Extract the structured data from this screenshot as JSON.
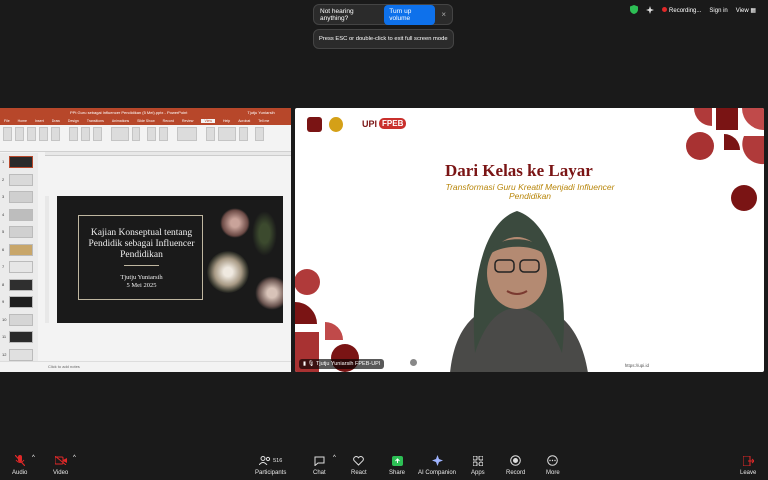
{
  "notices": {
    "hearing_text": "Not hearing anything?",
    "turn_up_label": "Turn up volume",
    "close_glyph": "×",
    "fullscreen_text": "Press ESC or double-click to exit full screen mode"
  },
  "top_right": {
    "recording_label": "Recording...",
    "signin_label": "Sign in",
    "view_label": "View"
  },
  "ppt": {
    "window_title": "PPt Guru sebagai Influencer Pendidikan (5 Mei).pptx - PowerPoint",
    "user_name": "Tjutju Yuniarsih",
    "tabs": [
      "File",
      "Home",
      "Insert",
      "Draw",
      "Design",
      "Transitions",
      "Animations",
      "Slide Show",
      "Record",
      "Review",
      "View",
      "Help",
      "Acrobat",
      "Tell me"
    ],
    "active_tab": "View",
    "slide_numbers": [
      "1",
      "2",
      "3",
      "4",
      "5",
      "6",
      "7",
      "8",
      "9",
      "10",
      "11",
      "12"
    ],
    "notes_placeholder": "Click to add notes",
    "slide": {
      "title": "Kajian Konseptual tentang Pendidik sebagai Influencer Pendidikan",
      "author": "Tjutju Yuniarsih",
      "date": "5 Mei 2025"
    }
  },
  "video": {
    "title": "Dari Kelas ke Layar",
    "subtitle": "Transformasi Guru Kreatif Menjadi Influencer Pendidikan",
    "logo_text": "UPI",
    "logo_badge": "FPEB",
    "participant_name": "Tjutju Yuniarsih FPEB-UPI",
    "url": "https://upi.id"
  },
  "toolbar": {
    "audio_label": "Audio",
    "video_label": "Video",
    "participants_label": "Participants",
    "participants_count": "516",
    "chat_label": "Chat",
    "react_label": "React",
    "share_label": "Share",
    "ai_label": "AI Companion",
    "apps_label": "Apps",
    "record_label": "Record",
    "more_label": "More",
    "leave_label": "Leave"
  },
  "colors": {
    "accent": "#0e71eb",
    "ppt_brand": "#b7472a",
    "recording": "#e02828",
    "title_maroon": "#7a1414"
  }
}
